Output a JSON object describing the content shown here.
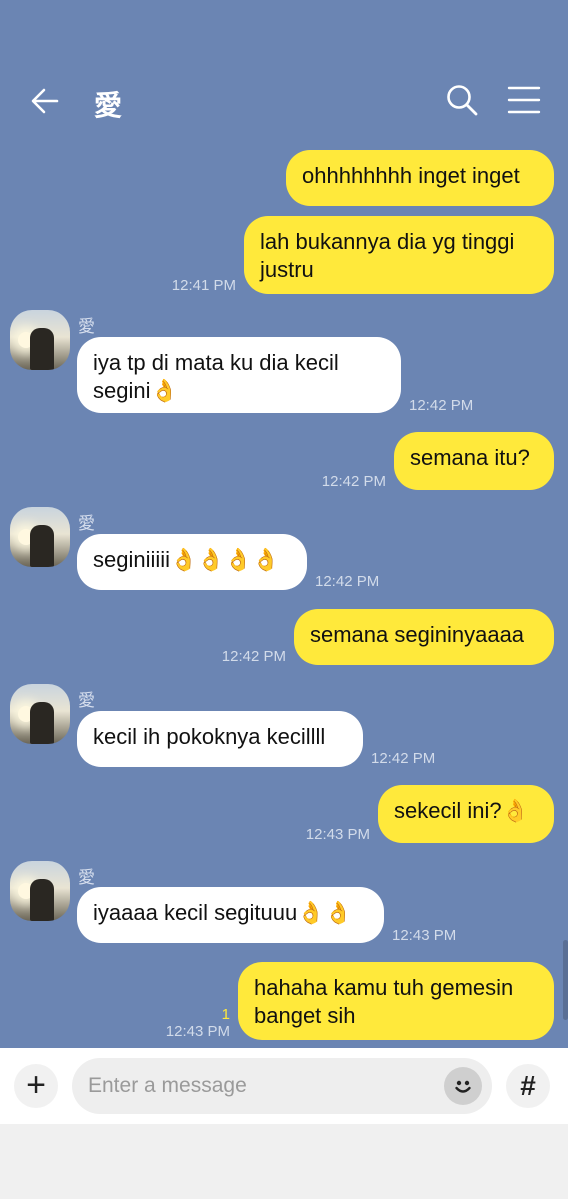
{
  "header": {
    "title": "愛"
  },
  "contact_name": "愛",
  "messages": [
    {
      "dir": "out",
      "text": "ohhhhhhhh inget inget",
      "time": ""
    },
    {
      "dir": "out",
      "text": "lah bukannya dia yg tinggi justru",
      "time": "12:41 PM"
    },
    {
      "dir": "in",
      "sender": "愛",
      "text": "iya tp di mata ku dia kecil segini👌",
      "time": "12:42 PM"
    },
    {
      "dir": "out",
      "text": "semana itu?",
      "time": "12:42 PM"
    },
    {
      "dir": "in",
      "sender": "愛",
      "text": "seginiiiii👌👌👌👌",
      "time": "12:42 PM"
    },
    {
      "dir": "out",
      "text": "semana segininyaaaa",
      "time": "12:42 PM"
    },
    {
      "dir": "in",
      "sender": "愛",
      "text": "kecil ih pokoknya kecillll",
      "time": "12:42 PM"
    },
    {
      "dir": "out",
      "text": "sekecil ini?👌",
      "time": "12:43 PM"
    },
    {
      "dir": "in",
      "sender": "愛",
      "text": "iyaaaa kecil segituuu👌👌",
      "time": "12:43 PM"
    },
    {
      "dir": "out",
      "text": "hahaha kamu tuh gemesin banget sih",
      "time": "12:43 PM",
      "read_count": "1"
    }
  ],
  "input": {
    "placeholder": "Enter a message",
    "value": ""
  },
  "buttons": {
    "plus": "+",
    "hash": "#"
  },
  "colors": {
    "background": "#6b85b3",
    "outgoing": "#ffe93b",
    "incoming": "#ffffff"
  },
  "icons": {
    "back": "arrow-left-icon",
    "search": "search-icon",
    "menu": "hamburger-menu-icon",
    "emoji": "smiley-icon"
  }
}
